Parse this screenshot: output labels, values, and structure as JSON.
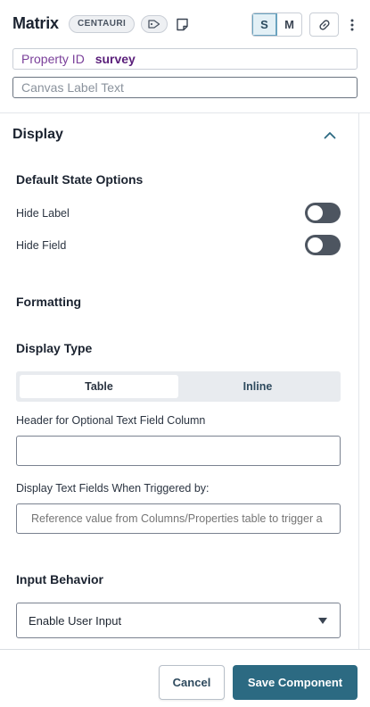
{
  "header": {
    "title": "Matrix",
    "badge": "CENTAURI",
    "size_options": [
      "S",
      "M"
    ],
    "active_size": "S",
    "property_id_label": "Property ID",
    "property_id_value": "survey",
    "canvas_label_placeholder": "Canvas Label Text"
  },
  "display": {
    "section_title": "Display",
    "default_state": {
      "heading": "Default State Options",
      "hide_label": "Hide Label",
      "hide_field": "Hide Field",
      "hide_label_on": false,
      "hide_field_on": false
    },
    "formatting_heading": "Formatting",
    "display_type": {
      "heading": "Display Type",
      "options": [
        "Table",
        "Inline"
      ],
      "selected": "Table"
    },
    "header_optional": {
      "label": "Header for Optional Text Field Column",
      "value": ""
    },
    "display_text_fields": {
      "label": "Display Text Fields When Triggered by:",
      "placeholder": "Reference value from Columns/Properties table to trigger a"
    },
    "input_behavior": {
      "heading": "Input Behavior",
      "selected": "Enable User Input"
    }
  },
  "footer": {
    "cancel_label": "Cancel",
    "save_label": "Save Component"
  },
  "colors": {
    "primary": "#2c6a82",
    "toggle_off": "#4d5560",
    "property_label": "#7a3f9a"
  }
}
